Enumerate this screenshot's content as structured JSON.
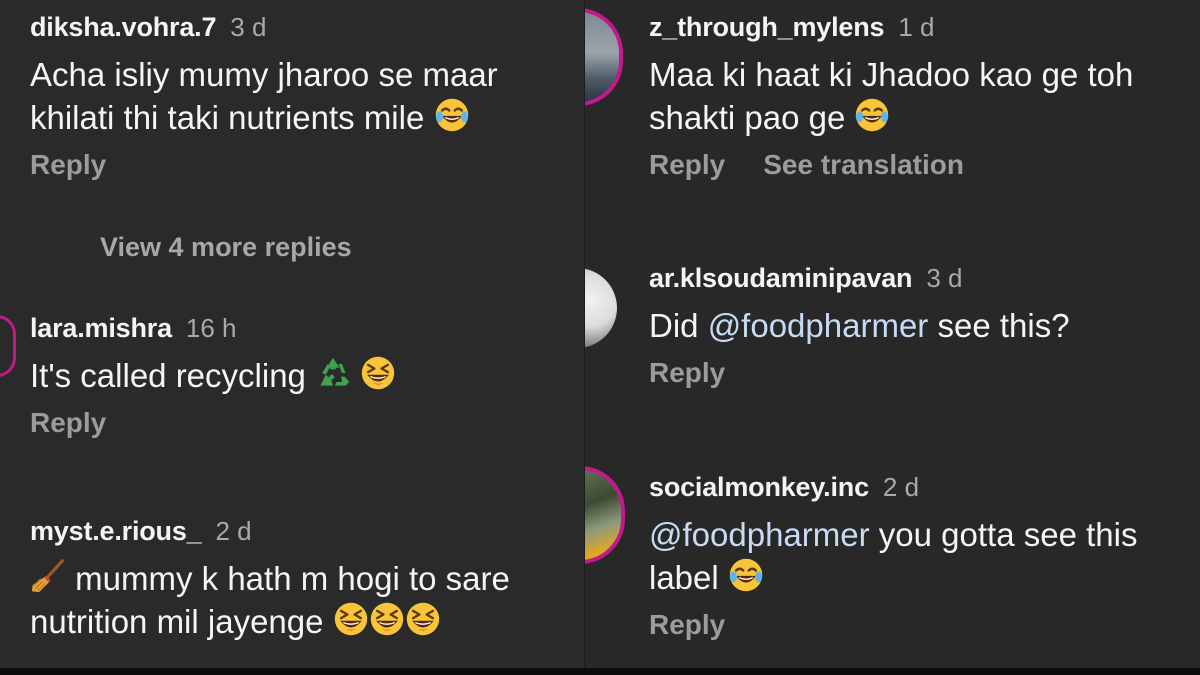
{
  "colors": {
    "background": "#2a2a2a",
    "mention": "#c7dbf4",
    "story_ring": "#c21a8d"
  },
  "left_column": {
    "c1": {
      "username": "diksha.vohra.7",
      "time": "3 d",
      "line1": "Acha isliy mumy jharoo se maar",
      "line2": "khilati thi taki nutrients mile",
      "emoji": "face-with-tears-of-joy",
      "reply": "Reply"
    },
    "view_more": "View 4 more replies",
    "c2": {
      "username": "lara.mishra",
      "time": "16 h",
      "text": "It's called recycling",
      "emojis": [
        "recycling-symbol",
        "grinning-squinting-face"
      ],
      "reply": "Reply"
    },
    "c3": {
      "username": "myst.e.rious_",
      "time": "2 d",
      "line1": "mummy k hath m hogi to sare",
      "line2": "nutrition mil jayenge",
      "emojis": [
        "broom",
        "grinning-squinting-face",
        "grinning-squinting-face",
        "grinning-squinting-face"
      ]
    }
  },
  "right_column": {
    "c1": {
      "username": "z_through_mylens",
      "time": "1 d",
      "line1": "Maa ki haat ki Jhadoo kao ge toh",
      "line2": "shakti pao ge",
      "emoji": "face-with-tears-of-joy",
      "reply": "Reply",
      "translate": "See translation"
    },
    "c2": {
      "username": "ar.klsoudaminipavan",
      "time": "3 d",
      "text_prefix": "Did ",
      "mention": "@foodpharmer",
      "text_suffix": " see this?",
      "reply": "Reply"
    },
    "c3": {
      "username": "socialmonkey.inc",
      "time": "2 d",
      "mention": "@foodpharmer",
      "text_suffix": " you gotta see this",
      "line2": "label",
      "emoji": "face-with-tears-of-joy",
      "reply": "Reply"
    }
  }
}
